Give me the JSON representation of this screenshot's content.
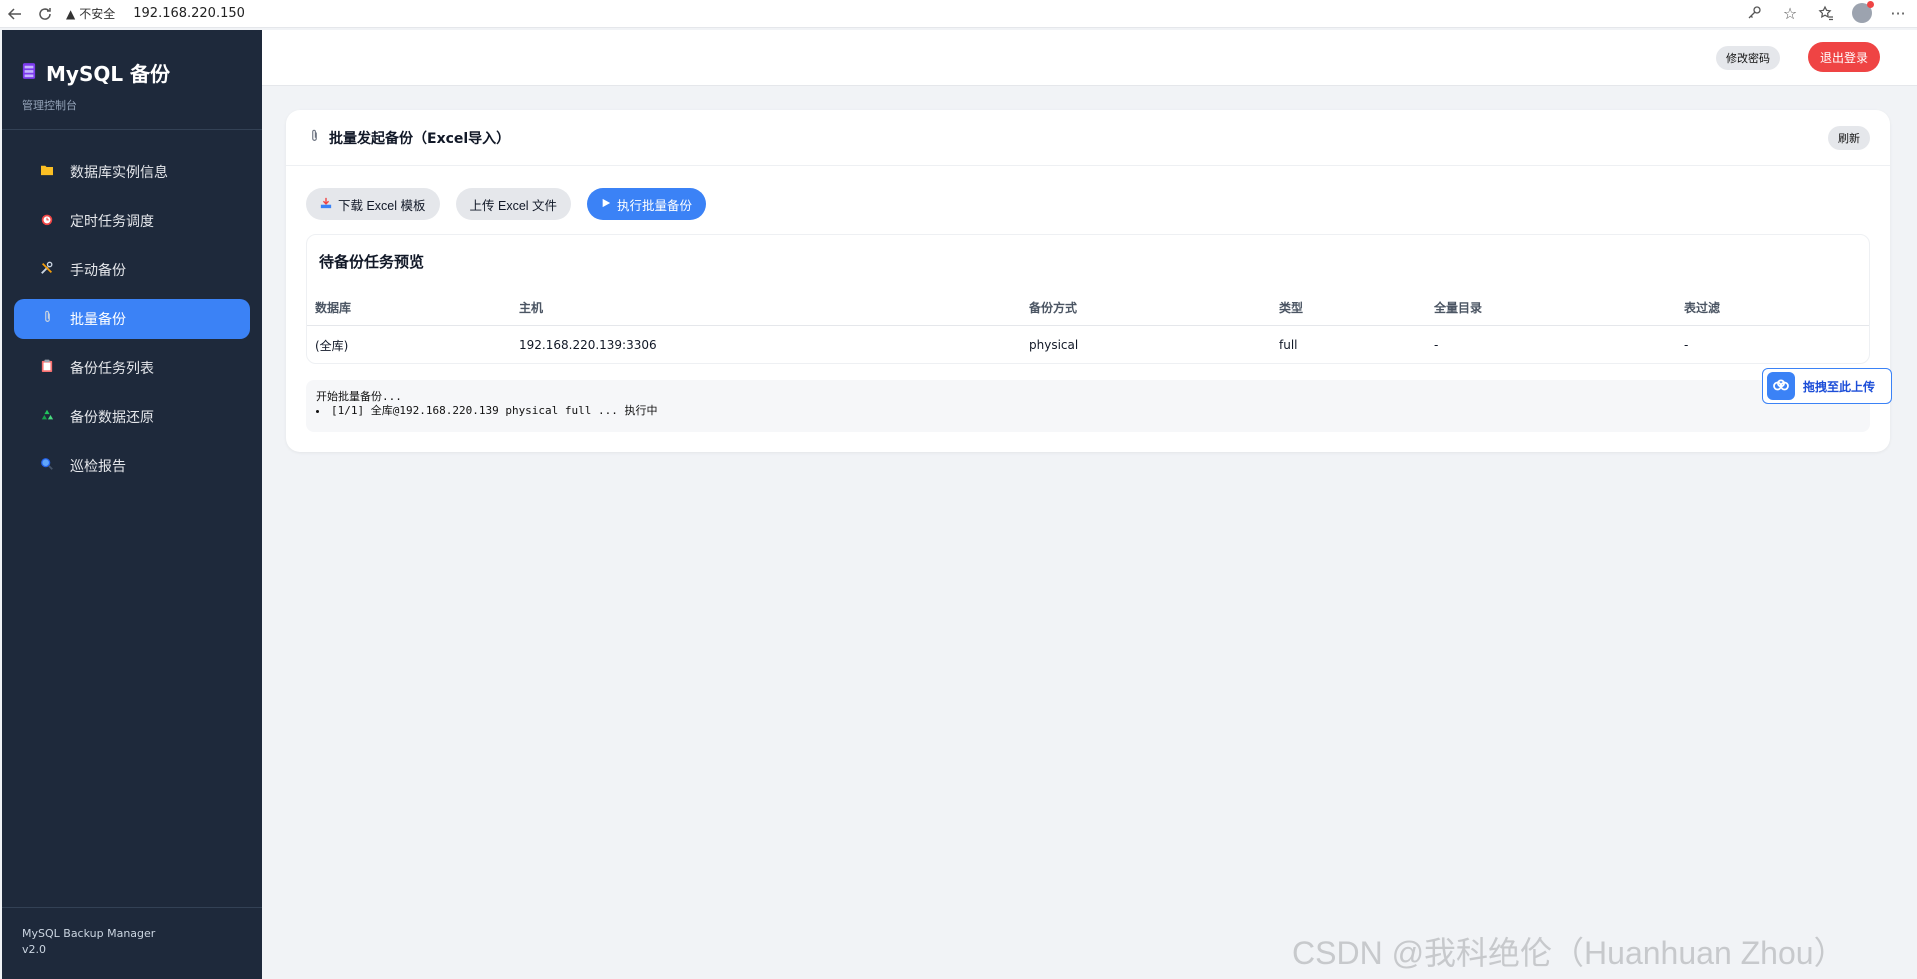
{
  "browser": {
    "security_label": "不安全",
    "url": "192.168.220.150"
  },
  "sidebar": {
    "brand_title": "MySQL 备份",
    "brand_sub": "管理控制台",
    "items": [
      {
        "label": "数据库实例信息",
        "icon": "folder-icon"
      },
      {
        "label": "定时任务调度",
        "icon": "alarm-clock-icon"
      },
      {
        "label": "手动备份",
        "icon": "tools-icon"
      },
      {
        "label": "批量备份",
        "icon": "paperclip-icon"
      },
      {
        "label": "备份任务列表",
        "icon": "clipboard-icon"
      },
      {
        "label": "备份数据还原",
        "icon": "recycle-icon"
      },
      {
        "label": "巡检报告",
        "icon": "magnifier-icon"
      }
    ],
    "active_index": 3,
    "footer_name": "MySQL Backup Manager",
    "footer_version": "v2.0"
  },
  "topbar": {
    "change_password": "修改密码",
    "logout": "退出登录"
  },
  "card": {
    "title": "批量发起备份（Excel导入）",
    "refresh": "刷新",
    "download_template": "下载 Excel 模板",
    "upload_file": "上传 Excel 文件",
    "execute": "执行批量备份"
  },
  "preview": {
    "title": "待备份任务预览",
    "columns": [
      "数据库",
      "主机",
      "备份方式",
      "类型",
      "全量目录",
      "表过滤"
    ],
    "rows": [
      [
        "(全库)",
        "192.168.220.139:3306",
        "physical",
        "full",
        "-",
        "-"
      ]
    ]
  },
  "log": {
    "line1": "开始批量备份...",
    "items": [
      "[1/1] 全库@192.168.220.139 physical full ... 执行中"
    ]
  },
  "float_upload": {
    "label": "拖拽至此上传"
  },
  "watermark": "CSDN @我科绝伦（Huanhuan Zhou）",
  "colors": {
    "sidebar_bg": "#1e293b",
    "accent": "#3b82f6",
    "danger": "#ef4444"
  }
}
